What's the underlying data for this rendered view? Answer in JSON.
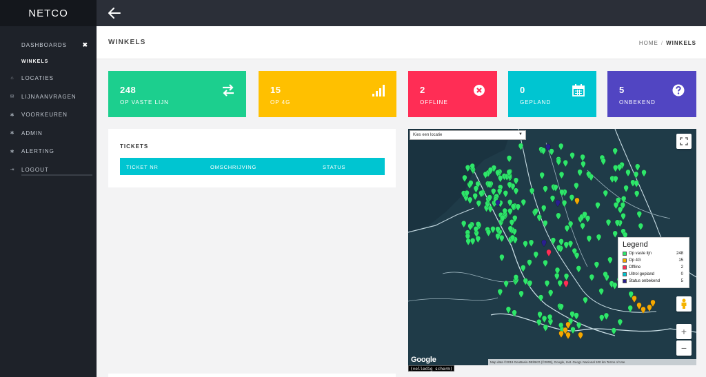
{
  "app": {
    "brand": "NETCO"
  },
  "sidebar": {
    "items": [
      {
        "label": "DASHBOARDS",
        "icon": "none",
        "has_close": true
      },
      {
        "label": "WINKELS",
        "icon": "none",
        "sub": true
      },
      {
        "label": "LOCATIES",
        "icon": "home-icon"
      },
      {
        "label": "LIJNAANVRAGEN",
        "icon": "envelope-icon"
      },
      {
        "label": "VOORKEUREN",
        "icon": "gear-icon"
      },
      {
        "label": "ADMIN",
        "icon": "gear-icon"
      },
      {
        "label": "ALERTING",
        "icon": "gear-icon"
      },
      {
        "label": "LOGOUT",
        "icon": "sign-out-icon"
      }
    ]
  },
  "header": {
    "title": "WINKELS",
    "breadcrumb": {
      "home": "HOME",
      "separator": "/",
      "current": "WINKELS"
    }
  },
  "tiles": [
    {
      "value": "248",
      "label": "OP VASTE LIJN",
      "color": "#1ccf8e",
      "icon": "exchange-icon"
    },
    {
      "value": "15",
      "label": "OP 4G",
      "color": "#ffc000",
      "icon": "signal-icon"
    },
    {
      "value": "2",
      "label": "OFFLINE",
      "color": "#ff2d55",
      "icon": "times-circle-icon"
    },
    {
      "value": "0",
      "label": "GEPLAND",
      "color": "#00c5d1",
      "icon": "calendar-icon"
    },
    {
      "value": "5",
      "label": "ONBEKEND",
      "color": "#5145c2",
      "icon": "question-circle-icon"
    }
  ],
  "tickets": {
    "title": "TICKETS",
    "columns": [
      "TICKET NR",
      "OMSCHRIJVING",
      "STATUS"
    ],
    "header_color": "#00c5d1"
  },
  "map": {
    "location_select": {
      "selected": "Kies een locatie"
    },
    "legend": {
      "title": "Legend",
      "items": [
        {
          "name": "Op vaste lijn",
          "count": "248",
          "color": "#2ee66b"
        },
        {
          "name": "Op 4G",
          "count": "15",
          "color": "#f5a800"
        },
        {
          "name": "Offline",
          "count": "2",
          "color": "#ff2d55"
        },
        {
          "name": "Uitrol gepland",
          "count": "0",
          "color": "#00c5d1"
        },
        {
          "name": "Status onbekend",
          "count": "5",
          "color": "#2a1f8f"
        }
      ]
    },
    "google_logo": "Google",
    "attribution": "Map data ©2019 GeoBasis-DE/BKG (©2009), Google, Inst. Geogr. Nacional  100 km  Terms of Use",
    "fullscreen_label": "(volledig scherm)",
    "zoom_in": "+",
    "zoom_out": "−"
  }
}
